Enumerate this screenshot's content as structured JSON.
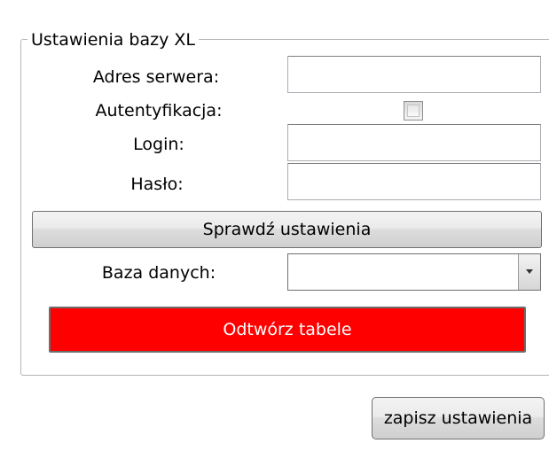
{
  "group": {
    "title": "Ustawienia bazy XL"
  },
  "fields": {
    "server_label": "Adres serwera:",
    "server_value": "",
    "auth_label": "Autentyfikacja:",
    "auth_checked": false,
    "login_label": "Login:",
    "login_value": "",
    "password_label": "Hasło:",
    "password_value": "",
    "database_label": "Baza danych:",
    "database_selected": ""
  },
  "buttons": {
    "check_settings": "Sprawdź ustawienia",
    "recreate_tables": "Odtwórz tabele",
    "save_settings": "zapisz ustawienia"
  },
  "colors": {
    "recreate_button_bg": "#ff0000",
    "recreate_button_text": "#ffffff"
  }
}
